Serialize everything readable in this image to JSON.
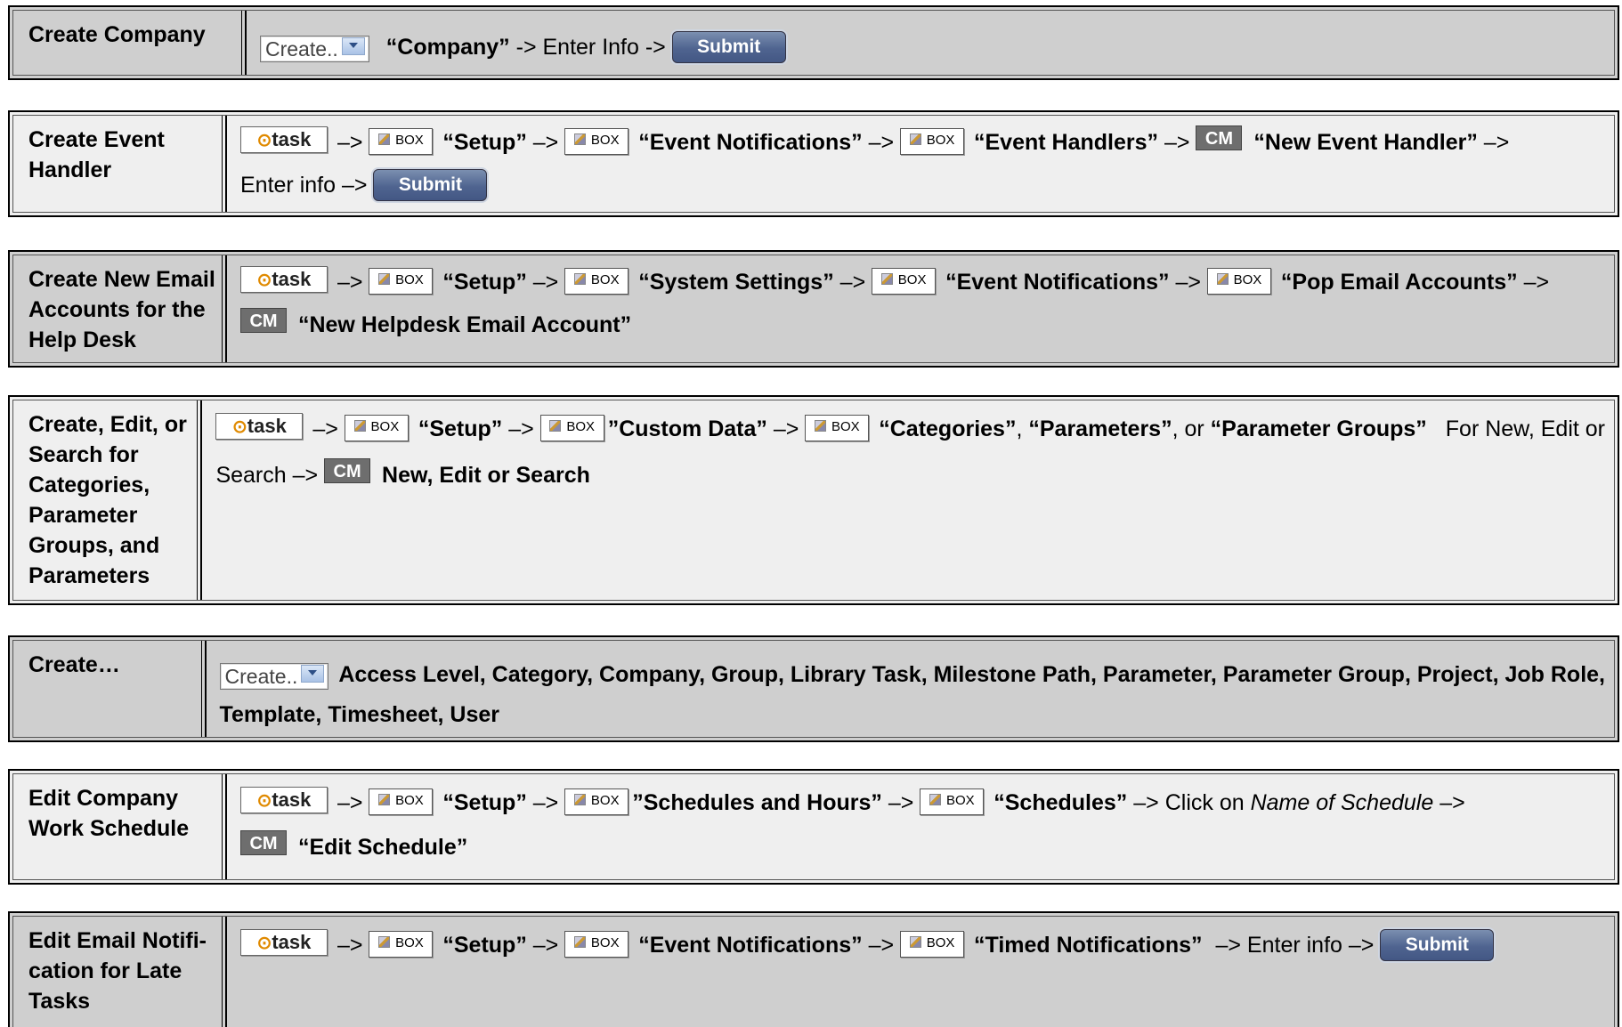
{
  "rows": [
    {
      "label": "Create Company",
      "line1": {
        "dropdown": "Create..",
        "t1": "“Company”",
        "t2": " -> Enter Info -> ",
        "submit": "Submit"
      }
    },
    {
      "label": "Create Event Handler",
      "line1": {
        "task": "task",
        "a1": "–>",
        "box1": "BOX",
        "s1": "“Setup”",
        "a2": "–>",
        "box2": "BOX",
        "s2": "“Event Notifications”",
        "a3": "–>",
        "box3": "BOX",
        "s3": "“Event Handlers”",
        "a4": "–>",
        "cm": "CM",
        "s4": "“New Event Handler”",
        "a5": "–>"
      },
      "line2": {
        "t1": "Enter info –>",
        "submit": "Submit"
      }
    },
    {
      "label": "Create New Email Accounts for the Help Desk",
      "line1": {
        "task": "task",
        "a1": "–>",
        "box1": "BOX",
        "s1": "“Setup”",
        "a2": "–>",
        "box2": "BOX",
        "s2": "“System Settings”",
        "a3": "–>",
        "box3": "BOX",
        "s3": "“Event Notifications”",
        "a4": "–>",
        "box4": "BOX",
        "s4": "“Pop Email Accounts”",
        "a5": "–>"
      },
      "line2": {
        "cm": "CM",
        "s1": "“New Helpdesk Email Account”"
      }
    },
    {
      "label": "Create, Edit, or Search for Categories, Parameter Groups, and Parameters",
      "line1": {
        "task": "task",
        "a1": "–>",
        "box1": "BOX",
        "s1": "“Setup”",
        "a2": "–>",
        "box2": "BOX",
        "s2": "”Custom Data”",
        "a3": "–>",
        "box3": "BOX",
        "s3": "“Categories”",
        "c1": ", ",
        "s4": "“Parameters”",
        "c2": ", or ",
        "s5": "“Parameter Groups”",
        "t1": "For New, Edit or"
      },
      "line2": {
        "t1": "Search –>",
        "cm": "CM",
        "s1": "New, Edit or Search"
      }
    },
    {
      "label": "Create…",
      "line1": {
        "dropdown": "Create..",
        "s1": "Access Level, Category, Company, Group, Library Task, Milestone Path, Parameter, Parameter Group, Project, Job Role,"
      },
      "line2": {
        "s1": "Template, Timesheet, User"
      }
    },
    {
      "label": "Edit Company Work Schedule",
      "line1": {
        "task": "task",
        "a1": "–>",
        "box1": "BOX",
        "s1": "“Setup”",
        "a2": "–>",
        "box2": "BOX",
        "s2": "”Schedules and Hours”",
        "a3": "–>",
        "box3": "BOX",
        "s3": "“Schedules”",
        "t1": "–> Click on ",
        "i1": "Name of Schedule",
        "t2": " –>"
      },
      "line2": {
        "cm": "CM",
        "s1": "“Edit Schedule”"
      }
    },
    {
      "label": "Edit Email Notifi-cation for Late Tasks",
      "line1": {
        "task": "task",
        "a1": "–>",
        "box1": "BOX",
        "s1": "“Setup”",
        "a2": "–>",
        "box2": "BOX",
        "s2": "“Event Notifications”",
        "a3": "–>",
        "box3": "BOX",
        "s3": "“Timed Notifications”",
        "t1": "–> Enter info –>",
        "submit": "Submit"
      }
    }
  ]
}
